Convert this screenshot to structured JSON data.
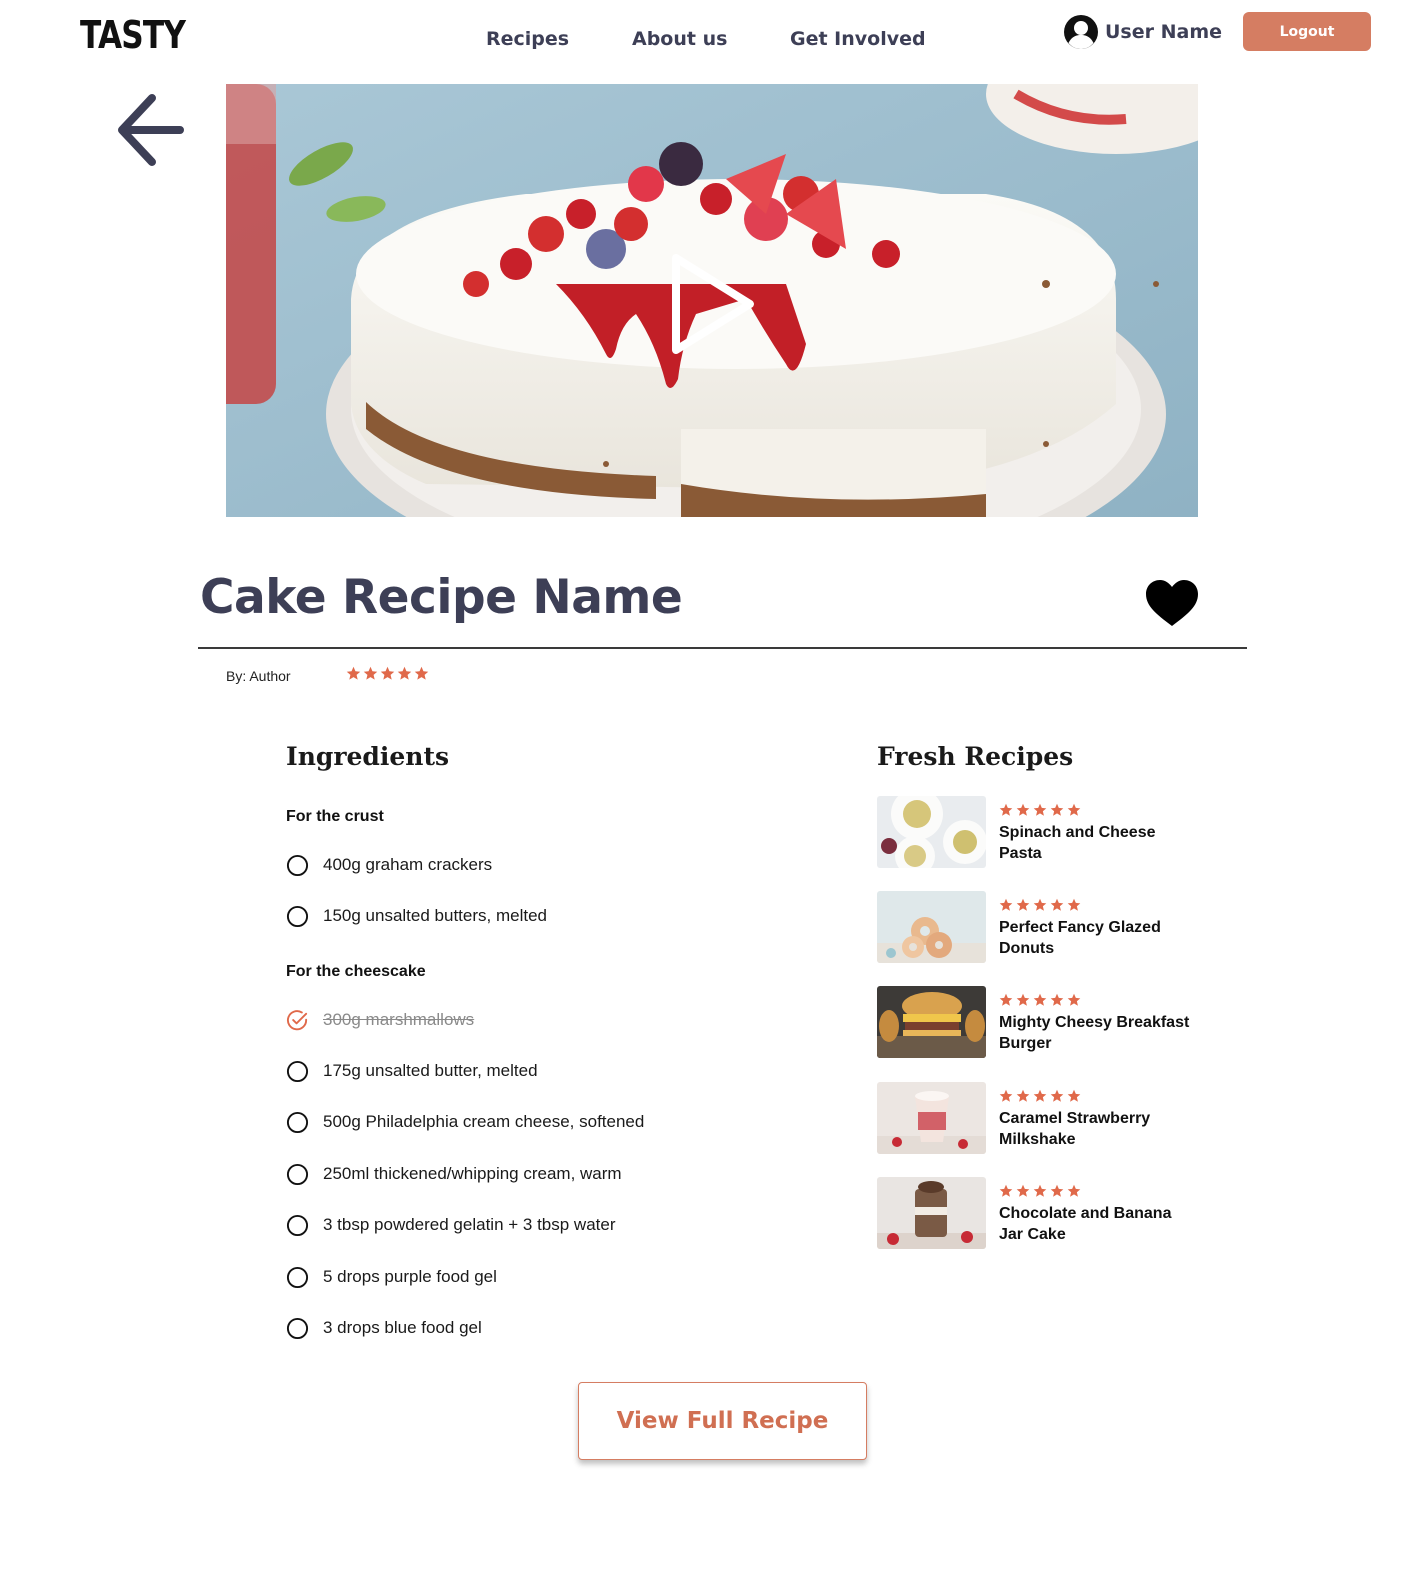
{
  "brand": {
    "logo_text": "TASTY"
  },
  "nav": {
    "items": [
      "Recipes",
      "About us",
      "Get Involved"
    ]
  },
  "user": {
    "name": "User Name",
    "avatar_icon": "user-circle-icon"
  },
  "header": {
    "logout_label": "Logout"
  },
  "hero": {
    "image": "cheesecake-with-berries-photo",
    "play_icon": "play-icon"
  },
  "recipe": {
    "title": "Cake Recipe Name",
    "author": "By: Author",
    "rating": 5,
    "favorite_icon": "heart-icon"
  },
  "ingredients": {
    "heading": "Ingredients",
    "groups": [
      {
        "title": "For the crust",
        "items": [
          {
            "text": "400g graham crackers",
            "checked": false
          },
          {
            "text": "150g unsalted butters, melted",
            "checked": false
          }
        ]
      },
      {
        "title": "For the cheescake",
        "items": [
          {
            "text": "300g marshmallows",
            "checked": true
          },
          {
            "text": "175g unsalted butter, melted",
            "checked": false
          },
          {
            "text": "500g Philadelphia cream cheese, softened",
            "checked": false
          },
          {
            "text": "250ml thickened/whipping cream, warm",
            "checked": false
          },
          {
            "text": "3 tbsp powdered gelatin + 3 tbsp water",
            "checked": false
          },
          {
            "text": "5 drops purple food gel",
            "checked": false
          },
          {
            "text": "3 drops blue food gel",
            "checked": false
          }
        ]
      }
    ]
  },
  "fresh": {
    "heading": "Fresh Recipes",
    "items": [
      {
        "name": "Spinach and Cheese Pasta",
        "rating": 5
      },
      {
        "name": "Perfect Fancy Glazed Donuts",
        "rating": 5
      },
      {
        "name": "Mighty Cheesy Breakfast Burger",
        "rating": 5
      },
      {
        "name": "Caramel Strawberry Milkshake",
        "rating": 5
      },
      {
        "name": "Chocolate and Banana Jar Cake",
        "rating": 5
      }
    ]
  },
  "cta": {
    "label": "View Full Recipe"
  },
  "colors": {
    "accent": "#d57d62",
    "star": "#e0694a",
    "heading": "#3d3f56"
  }
}
